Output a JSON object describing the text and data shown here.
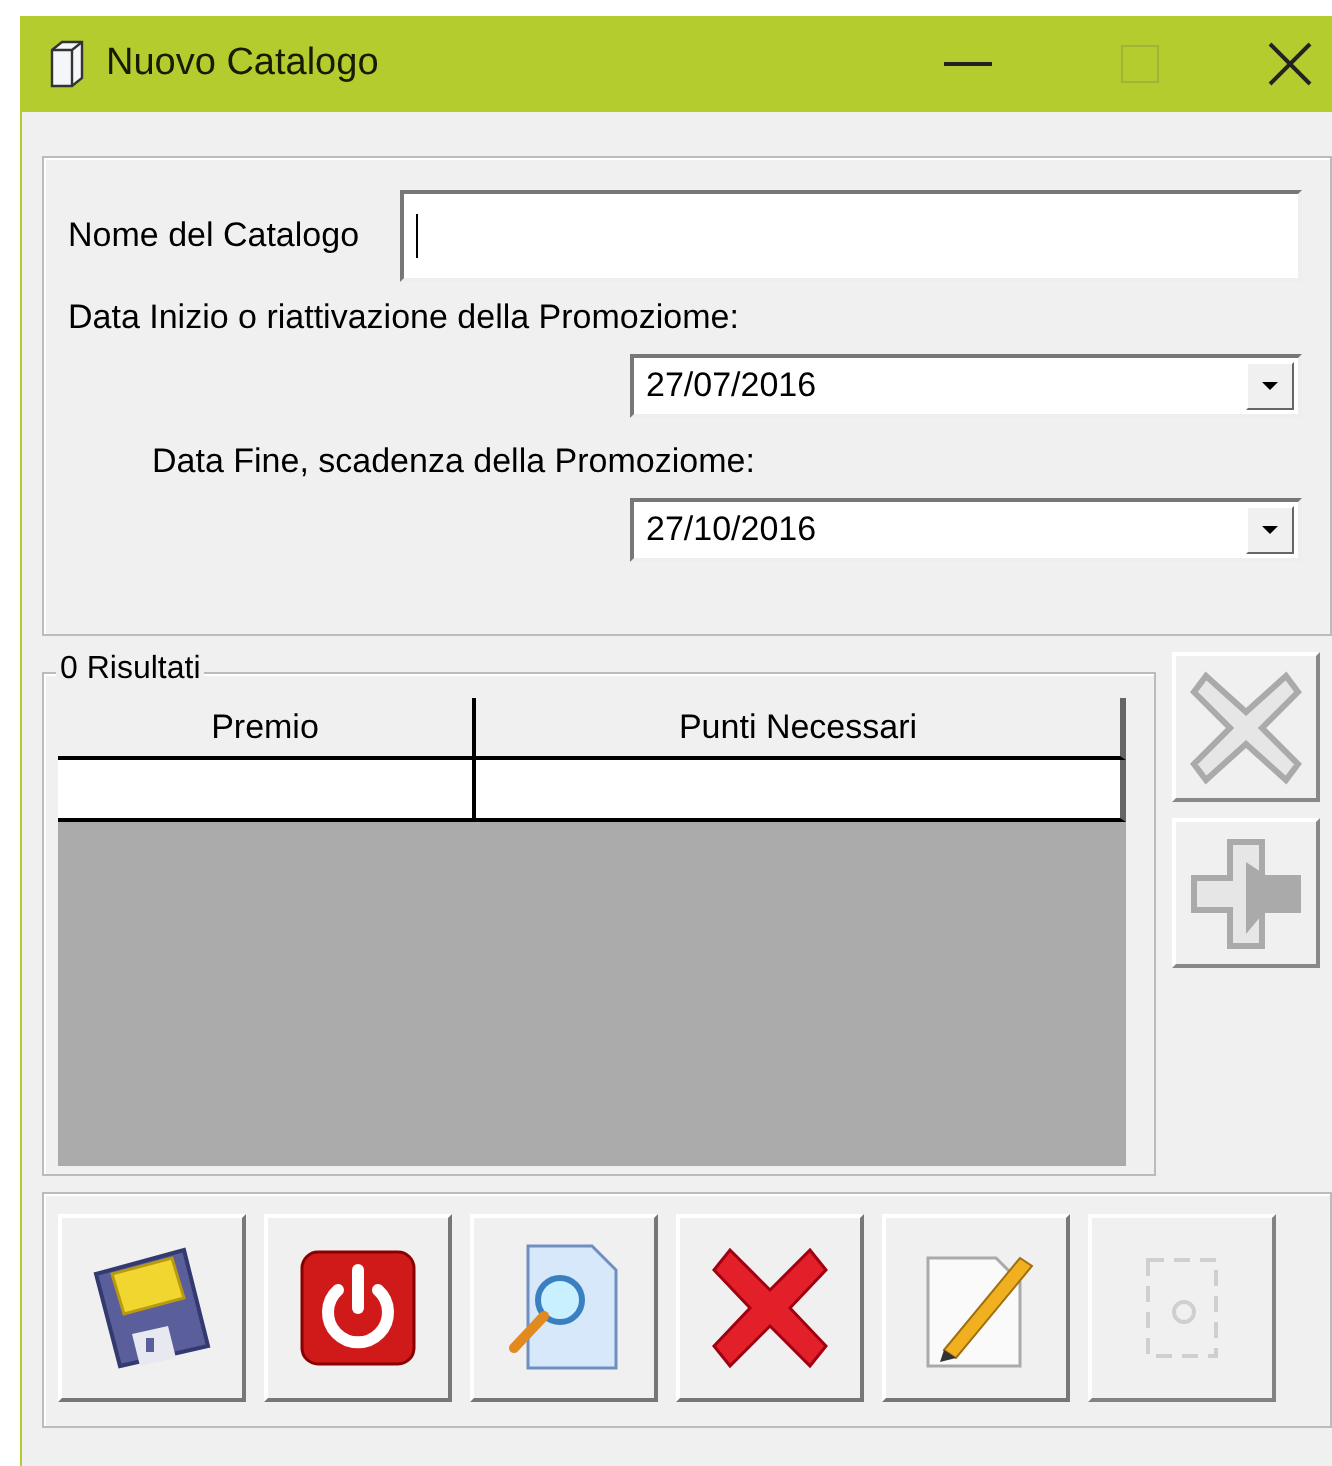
{
  "window": {
    "title": "Nuovo Catalogo"
  },
  "form": {
    "name_label": "Nome del Catalogo",
    "start_label": "Data Inizio o riattivazione della Promoziome:",
    "start_date": "27/07/2016",
    "end_label": "Data Fine, scadenza della Promoziome:",
    "end_date": "27/10/2016"
  },
  "results": {
    "legend": "0 Risultati",
    "columns": [
      "Premio",
      "Punti Necessari"
    ]
  },
  "side_buttons": [
    {
      "kind": "delete",
      "disabled": true
    },
    {
      "kind": "add",
      "disabled": true
    }
  ],
  "toolbar": [
    {
      "kind": "save",
      "disabled": false
    },
    {
      "kind": "power",
      "disabled": false
    },
    {
      "kind": "preview",
      "disabled": false
    },
    {
      "kind": "cancel",
      "disabled": false
    },
    {
      "kind": "edit",
      "disabled": false
    },
    {
      "kind": "other",
      "disabled": true
    }
  ]
}
